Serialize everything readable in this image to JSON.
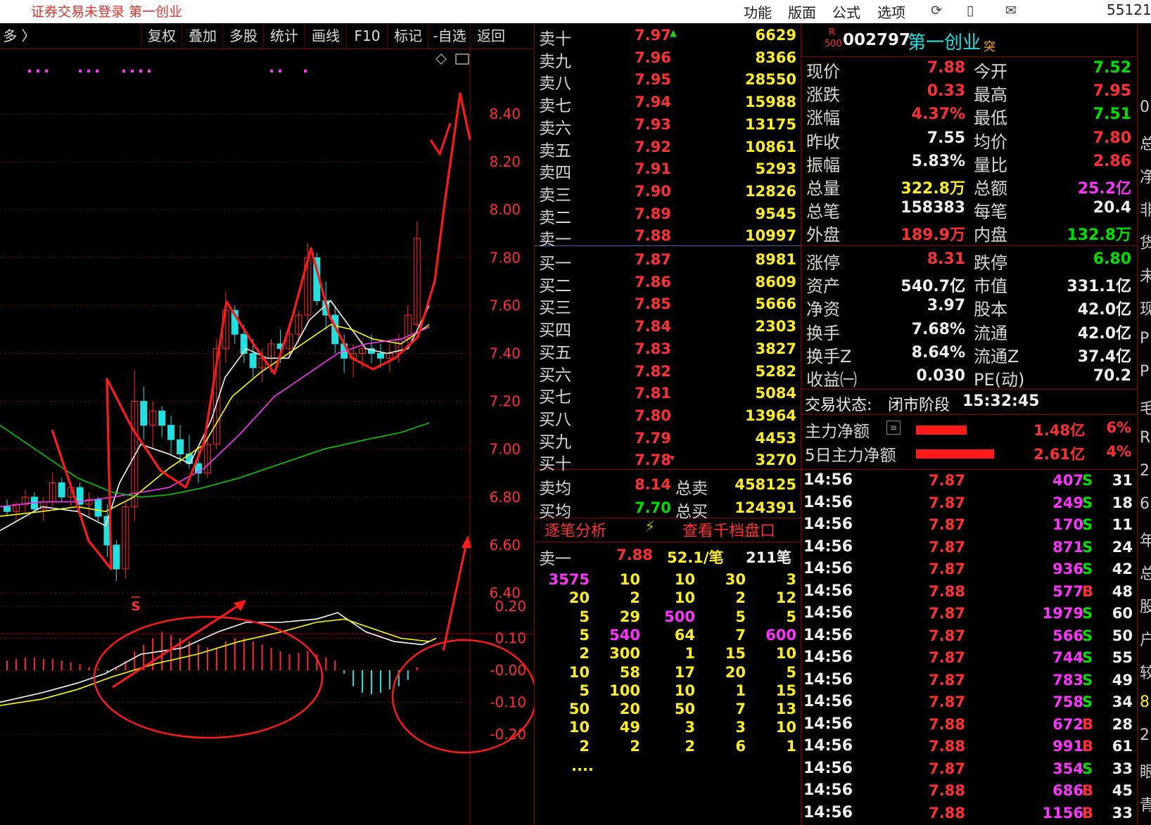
{
  "window": {
    "title": "证券交易未登录  第一创业",
    "menu": [
      "功能",
      "版面",
      "公式",
      "选项"
    ],
    "icons": [
      "refresh-icon",
      "phone-icon",
      "mail-icon"
    ],
    "clock": "55121"
  },
  "toolbar": {
    "left_label": "多 〉",
    "buttons": [
      "复权",
      "叠加",
      "多股",
      "统计",
      "画线",
      "F10",
      "标记",
      "-自选",
      "返回"
    ]
  },
  "chart": {
    "price_ticks": [
      "8.40",
      "8.20",
      "8.00",
      "7.80",
      "7.60",
      "7.40",
      "7.20",
      "7.00",
      "6.80",
      "6.60",
      "6.40"
    ],
    "macd_ticks": [
      "0.20",
      "0.10",
      "-0.00",
      "-0.10",
      "-0.20"
    ],
    "signal_label": "S",
    "colors": {
      "up": "#ff2a2a",
      "down": "#22e0e0",
      "ma5": "#ffffff",
      "ma10": "#ffff00",
      "ma20": "#ff33ff",
      "ma60": "#00cc00",
      "annotation": "#ff1a1a"
    }
  },
  "orderbook": {
    "asks": [
      {
        "label": "卖十",
        "price": "7.97",
        "vol": "6629",
        "mark": "▲"
      },
      {
        "label": "卖九",
        "price": "7.96",
        "vol": "8366",
        "mark": ""
      },
      {
        "label": "卖八",
        "price": "7.95",
        "vol": "28550",
        "mark": ""
      },
      {
        "label": "卖七",
        "price": "7.94",
        "vol": "15988",
        "mark": ""
      },
      {
        "label": "卖六",
        "price": "7.93",
        "vol": "13175",
        "mark": ""
      },
      {
        "label": "卖五",
        "price": "7.92",
        "vol": "10861",
        "mark": ""
      },
      {
        "label": "卖四",
        "price": "7.91",
        "vol": "5293",
        "mark": ""
      },
      {
        "label": "卖三",
        "price": "7.90",
        "vol": "12826",
        "mark": ""
      },
      {
        "label": "卖二",
        "price": "7.89",
        "vol": "9545",
        "mark": ""
      },
      {
        "label": "卖一",
        "price": "7.88",
        "vol": "10997",
        "mark": ""
      }
    ],
    "bids": [
      {
        "label": "买一",
        "price": "7.87",
        "vol": "8981",
        "mark": ""
      },
      {
        "label": "买二",
        "price": "7.86",
        "vol": "8609",
        "mark": ""
      },
      {
        "label": "买三",
        "price": "7.85",
        "vol": "5666",
        "mark": ""
      },
      {
        "label": "买四",
        "price": "7.84",
        "vol": "2303",
        "mark": ""
      },
      {
        "label": "买五",
        "price": "7.83",
        "vol": "3827",
        "mark": ""
      },
      {
        "label": "买六",
        "price": "7.82",
        "vol": "5282",
        "mark": ""
      },
      {
        "label": "买七",
        "price": "7.81",
        "vol": "5084",
        "mark": ""
      },
      {
        "label": "买八",
        "price": "7.80",
        "vol": "13964",
        "mark": ""
      },
      {
        "label": "买九",
        "price": "7.79",
        "vol": "4453",
        "mark": ""
      },
      {
        "label": "买十",
        "price": "7.78",
        "vol": "3270",
        "mark": "▾"
      }
    ],
    "avg": [
      {
        "label": "卖均",
        "price": "8.14",
        "tlabel": "总卖",
        "total": "458125"
      },
      {
        "label": "买均",
        "price": "7.70",
        "tlabel": "总买",
        "total": "124391"
      }
    ]
  },
  "tick_analysis": {
    "tab_left": "逐笔分析",
    "tab_right": "查看千档盘口",
    "ask1": {
      "label": "卖一",
      "price": "7.88",
      "avg": "52.1/笔",
      "count": "211笔"
    },
    "rows": [
      [
        "3575",
        "10",
        "10",
        "30",
        "3"
      ],
      [
        "20",
        "2",
        "10",
        "2",
        "12"
      ],
      [
        "5",
        "29",
        "500",
        "5",
        "5"
      ],
      [
        "5",
        "540",
        "64",
        "7",
        "600"
      ],
      [
        "2",
        "300",
        "1",
        "15",
        "10"
      ],
      [
        "10",
        "58",
        "17",
        "20",
        "5"
      ],
      [
        "5",
        "100",
        "10",
        "1",
        "15"
      ],
      [
        "50",
        "20",
        "50",
        "7",
        "13"
      ],
      [
        "10",
        "49",
        "3",
        "3",
        "10"
      ],
      [
        "2",
        "2",
        "2",
        "6",
        "1"
      ]
    ],
    "more": "...."
  },
  "stock": {
    "code": "002797",
    "name": "第一创业",
    "badge_r": "R",
    "badge_500": "500",
    "badge_tu": "突"
  },
  "quote": [
    {
      "l1": "现价",
      "v1": "7.88",
      "c1": "red",
      "l2": "今开",
      "v2": "7.52",
      "c2": "grn"
    },
    {
      "l1": "涨跌",
      "v1": "0.33",
      "c1": "red",
      "l2": "最高",
      "v2": "7.95",
      "c2": "red"
    },
    {
      "l1": "涨幅",
      "v1": "4.37%",
      "c1": "red",
      "l2": "最低",
      "v2": "7.51",
      "c2": "grn"
    },
    {
      "l1": "昨收",
      "v1": "7.55",
      "c1": "wht",
      "l2": "均价",
      "v2": "7.80",
      "c2": "red"
    },
    {
      "l1": "振幅",
      "v1": "5.83%",
      "c1": "wht",
      "l2": "量比",
      "v2": "2.86",
      "c2": "red"
    },
    {
      "l1": "总量",
      "v1": "322.8万",
      "c1": "yel",
      "l2": "总额",
      "v2": "25.2亿",
      "c2": "mag"
    },
    {
      "l1": "总笔",
      "v1": "158383",
      "c1": "wht",
      "l2": "每笔",
      "v2": "20.4",
      "c2": "wht"
    },
    {
      "l1": "外盘",
      "v1": "189.9万",
      "c1": "red",
      "l2": "内盘",
      "v2": "132.8万",
      "c2": "grn"
    }
  ],
  "fundamentals": [
    {
      "l1": "涨停",
      "v1": "8.31",
      "c1": "red",
      "l2": "跌停",
      "v2": "6.80",
      "c2": "grn"
    },
    {
      "l1": "资产",
      "v1": "540.7亿",
      "c1": "wht",
      "l2": "市值",
      "v2": "331.1亿",
      "c2": "wht"
    },
    {
      "l1": "净资",
      "v1": "3.97",
      "c1": "wht",
      "l2": "股本",
      "v2": "42.0亿",
      "c2": "wht"
    },
    {
      "l1": "换手",
      "v1": "7.68%",
      "c1": "wht",
      "l2": "流通",
      "v2": "42.0亿",
      "c2": "wht"
    },
    {
      "l1": "换手Z",
      "v1": "8.64%",
      "c1": "wht",
      "l2": "流通Z",
      "v2": "37.4亿",
      "c2": "wht"
    },
    {
      "l1": "收益㈠",
      "v1": "0.030",
      "c1": "wht",
      "l2": "PE(动)",
      "v2": "70.2",
      "c2": "wht"
    }
  ],
  "status": {
    "label": "交易状态:",
    "value": "闭市阶段",
    "time": "15:32:45"
  },
  "capital_flow": [
    {
      "label": "主力净额",
      "value": "1.48亿",
      "pct": "6%",
      "bar": 0.55
    },
    {
      "label": "5日主力净额",
      "value": "2.61亿",
      "pct": "4%",
      "bar": 0.85
    }
  ],
  "trades": [
    {
      "time": "14:56",
      "price": "7.87",
      "vol": "407",
      "side": "S",
      "n": "31"
    },
    {
      "time": "14:56",
      "price": "7.87",
      "vol": "249",
      "side": "S",
      "n": "18"
    },
    {
      "time": "14:56",
      "price": "7.87",
      "vol": "170",
      "side": "S",
      "n": "11"
    },
    {
      "time": "14:56",
      "price": "7.87",
      "vol": "871",
      "side": "S",
      "n": "24"
    },
    {
      "time": "14:56",
      "price": "7.87",
      "vol": "936",
      "side": "S",
      "n": "42"
    },
    {
      "time": "14:56",
      "price": "7.88",
      "vol": "577",
      "side": "B",
      "n": "48"
    },
    {
      "time": "14:56",
      "price": "7.87",
      "vol": "1979",
      "side": "S",
      "n": "60"
    },
    {
      "time": "14:56",
      "price": "7.87",
      "vol": "566",
      "side": "S",
      "n": "50"
    },
    {
      "time": "14:56",
      "price": "7.87",
      "vol": "744",
      "side": "S",
      "n": "55"
    },
    {
      "time": "14:56",
      "price": "7.87",
      "vol": "783",
      "side": "S",
      "n": "49"
    },
    {
      "time": "14:56",
      "price": "7.87",
      "vol": "758",
      "side": "S",
      "n": "34"
    },
    {
      "time": "14:56",
      "price": "7.88",
      "vol": "672",
      "side": "B",
      "n": "28"
    },
    {
      "time": "14:56",
      "price": "7.88",
      "vol": "991",
      "side": "B",
      "n": "61"
    },
    {
      "time": "14:56",
      "price": "7.87",
      "vol": "354",
      "side": "S",
      "n": "33"
    },
    {
      "time": "14:56",
      "price": "7.88",
      "vol": "686",
      "side": "B",
      "n": "45"
    },
    {
      "time": "14:56",
      "price": "7.88",
      "vol": "1156",
      "side": "B",
      "n": "33"
    }
  ],
  "edge_panel": [
    "0",
    "总",
    "净",
    "非",
    "货",
    "未",
    "现",
    "P",
    "P",
    "毛",
    "R",
    "2",
    "6",
    "年",
    "总",
    "股",
    "户",
    "较",
    "8",
    "2",
    "眼",
    "青"
  ]
}
